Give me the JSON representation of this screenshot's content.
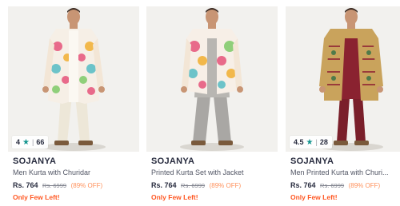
{
  "products": [
    {
      "brand": "SOJANYA",
      "title": "Men Kurta with Churidar",
      "price": "Rs. 764",
      "mrp": "Rs. 6999",
      "discount": "(89% OFF)",
      "stock": "Only Few Left!",
      "rating": "4",
      "rating_count": "66"
    },
    {
      "brand": "SOJANYA",
      "title": "Printed Kurta Set with Jacket",
      "price": "Rs. 764",
      "mrp": "Rs. 6999",
      "discount": "(89% OFF)",
      "stock": "Only Few Left!"
    },
    {
      "brand": "SOJANYA",
      "title": "Men Printed Kurta with Churi...",
      "price": "Rs. 764",
      "mrp": "Rs. 6999",
      "discount": "(89% OFF)",
      "stock": "Only Few Left!",
      "rating": "4.5",
      "rating_count": "28"
    }
  ],
  "colors": {
    "brand_text": "#282c3f",
    "discount": "#ff905a",
    "stock_alert": "#ff5722",
    "star": "#14958f"
  }
}
